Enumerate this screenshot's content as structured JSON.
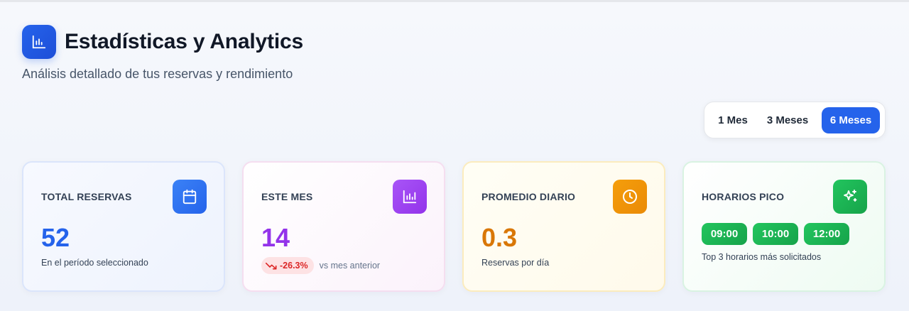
{
  "page": {
    "title": "Estadísticas y Analytics",
    "subtitle": "Análisis detallado de tus reservas y rendimiento"
  },
  "range_selector": {
    "options": [
      "1 Mes",
      "3 Meses",
      "6 Meses"
    ],
    "selected": "6 Meses"
  },
  "cards": {
    "total": {
      "label": "TOTAL RESERVAS",
      "value": "52",
      "note": "En el período seleccionado",
      "icon": "calendar-icon",
      "color": "#2563eb"
    },
    "month": {
      "label": "ESTE MES",
      "value": "14",
      "trend": "-26.3%",
      "trend_note": "vs mes anterior",
      "icon": "bar-chart-icon",
      "color": "#9333ea",
      "trend_color": "#dc2626"
    },
    "daily": {
      "label": "PROMEDIO DIARIO",
      "value": "0.3",
      "note": "Reservas por día",
      "icon": "clock-icon",
      "color": "#d97706"
    },
    "peak": {
      "label": "HORARIOS PICO",
      "hours": [
        "09:00",
        "10:00",
        "12:00"
      ],
      "note": "Top 3 horarios más solicitados",
      "icon": "sparkles-icon",
      "color": "#16a34a"
    }
  }
}
